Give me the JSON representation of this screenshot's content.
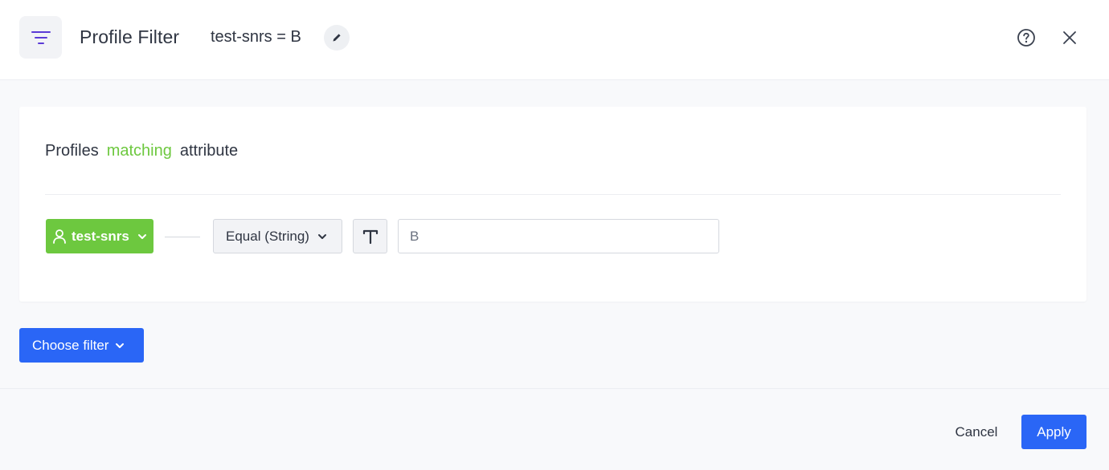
{
  "header": {
    "title": "Profile Filter",
    "filter_name": "test-snrs = B",
    "icons": {
      "filter": "filter-lines-icon",
      "edit": "pencil-icon",
      "help": "question-circle-icon",
      "close": "close-icon"
    }
  },
  "card": {
    "heading": {
      "prefix": "Profiles",
      "accent": "matching",
      "suffix": "attribute"
    },
    "condition": {
      "attribute": "test-snrs",
      "operator": "Equal (String)",
      "type_icon": "text-type-icon",
      "value": "B"
    }
  },
  "actions": {
    "choose_filter": "Choose filter",
    "cancel": "Cancel",
    "apply": "Apply"
  },
  "colors": {
    "accent_green": "#6dc83f",
    "primary_blue": "#2a66f6",
    "filter_icon_purple": "#5b3bd6"
  }
}
